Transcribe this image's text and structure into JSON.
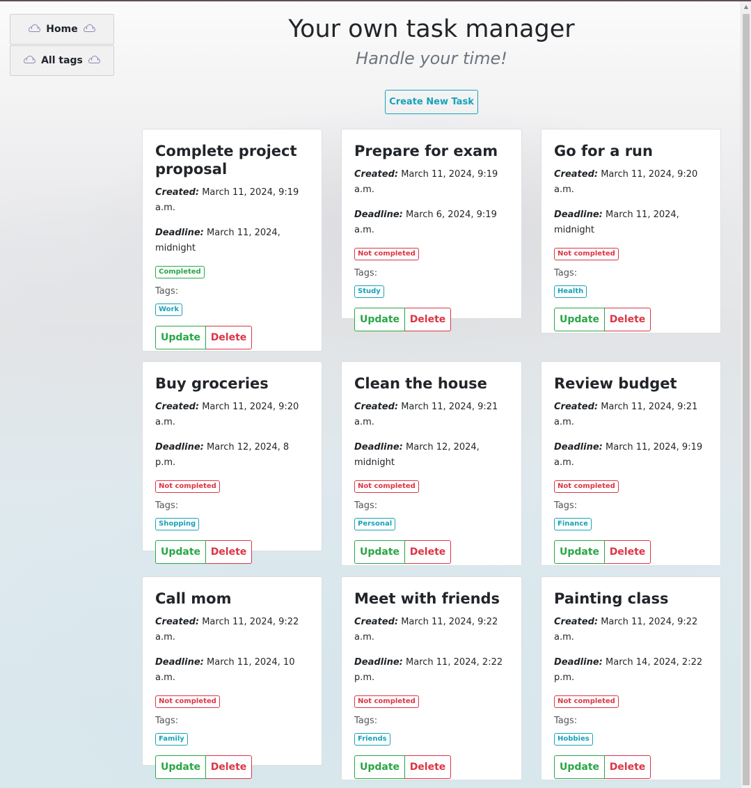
{
  "nav": {
    "home_label": "Home",
    "tags_label": "All tags"
  },
  "header": {
    "title": "Your own task manager",
    "subtitle": "Handle your time!"
  },
  "create_button": "Create New Task",
  "labels": {
    "created": "Created:",
    "deadline": "Deadline:",
    "tags": "Tags:",
    "update": "Update",
    "delete": "Delete"
  },
  "colors": {
    "success": "#28a745",
    "danger": "#dc3545",
    "info": "#17a2b8"
  },
  "icons": {
    "nav": "cloud-icon"
  },
  "tasks": [
    {
      "title": "Complete project proposal",
      "created": "March 11, 2024, 9:19 a.m.",
      "deadline": "March 11, 2024, midnight",
      "status": "Completed",
      "tag": "Work"
    },
    {
      "title": "Prepare for exam",
      "created": "March 11, 2024, 9:19 a.m.",
      "deadline": "March 6, 2024, 9:19 a.m.",
      "status": "Not completed",
      "tag": "Study"
    },
    {
      "title": "Go for a run",
      "created": "March 11, 2024, 9:20 a.m.",
      "deadline": "March 11, 2024, midnight",
      "status": "Not completed",
      "tag": "Health"
    },
    {
      "title": "Buy groceries",
      "created": "March 11, 2024, 9:20 a.m.",
      "deadline": "March 12, 2024, 8 p.m.",
      "status": "Not completed",
      "tag": "Shopping"
    },
    {
      "title": "Clean the house",
      "created": "March 11, 2024, 9:21 a.m.",
      "deadline": "March 12, 2024, midnight",
      "status": "Not completed",
      "tag": "Personal"
    },
    {
      "title": "Review budget",
      "created": "March 11, 2024, 9:21 a.m.",
      "deadline": "March 11, 2024, 9:19 a.m.",
      "status": "Not completed",
      "tag": "Finance"
    },
    {
      "title": "Call mom",
      "created": "March 11, 2024, 9:22 a.m.",
      "deadline": "March 11, 2024, 10 a.m.",
      "status": "Not completed",
      "tag": "Family"
    },
    {
      "title": "Meet with friends",
      "created": "March 11, 2024, 9:22 a.m.",
      "deadline": "March 11, 2024, 2:22 p.m.",
      "status": "Not completed",
      "tag": "Friends"
    },
    {
      "title": "Painting class",
      "created": "March 11, 2024, 9:22 a.m.",
      "deadline": "March 14, 2024, 2:22 p.m.",
      "status": "Not completed",
      "tag": "Hobbies"
    }
  ]
}
